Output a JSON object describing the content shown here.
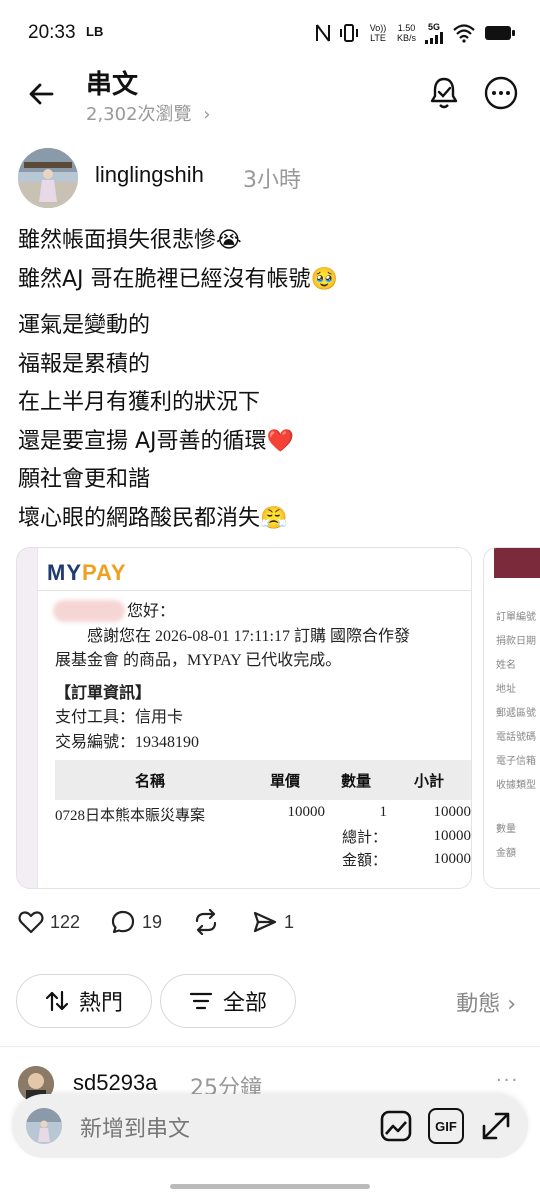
{
  "status_bar": {
    "time": "20:33",
    "app_badge": "LB",
    "net_small_1": "Vo)) LTE",
    "speed_value": "1.50",
    "speed_unit": "KB/s",
    "network": "5G"
  },
  "header": {
    "title": "串文",
    "views": "2,302次瀏覽",
    "views_chevron": "›"
  },
  "post": {
    "username": "linglingshih",
    "time": "3小時",
    "paragraph_1": [
      "雖然帳面損失很悲慘😭",
      "雖然AJ 哥在脆裡已經沒有帳號🥹"
    ],
    "paragraph_2": [
      "運氣是變動的",
      "福報是累積的",
      "在上半月有獲利的狀況下",
      "還是要宣揚 AJ哥善的循環❤️",
      "願社會更和諧",
      "壞心眼的網路酸民都消失😤"
    ]
  },
  "receipt": {
    "logo_my": "MY",
    "logo_pay": "PAY",
    "greeting": "您好：",
    "thanks_1": "感謝您在 2026-08-01 17:11:17 訂購 國際合作發",
    "thanks_2": "展基金會 的商品，MYPAY 已代收完成。",
    "section_title": "【訂單資訊】",
    "payment_tool": "支付工具：信用卡",
    "transaction_no": "交易編號：19348190",
    "table_headers": [
      "名稱",
      "單價",
      "數量",
      "小計"
    ],
    "item_name": "0728日本熊本賑災專案",
    "item_price": "10000",
    "item_qty": "1",
    "item_subtotal": "10000",
    "total_label": "總計：",
    "total_value": "10000",
    "amount_label": "金額：",
    "amount_value": "10000"
  },
  "second_card": {
    "items": [
      "訂單編號",
      "捐款日期",
      "姓名",
      "地址",
      "郵遞區號",
      "電話號碼",
      "電子信箱",
      "收據類型",
      "數量",
      "金額"
    ]
  },
  "actions": {
    "likes": "122",
    "comments": "19",
    "shares": "1"
  },
  "filters": {
    "hot": "熱門",
    "all": "全部",
    "activity": "動態 ›"
  },
  "reply": {
    "username": "sd5293a",
    "time": "25分鐘",
    "more": "···"
  },
  "composer": {
    "placeholder": "新增到串文",
    "gif_label": "GIF"
  }
}
